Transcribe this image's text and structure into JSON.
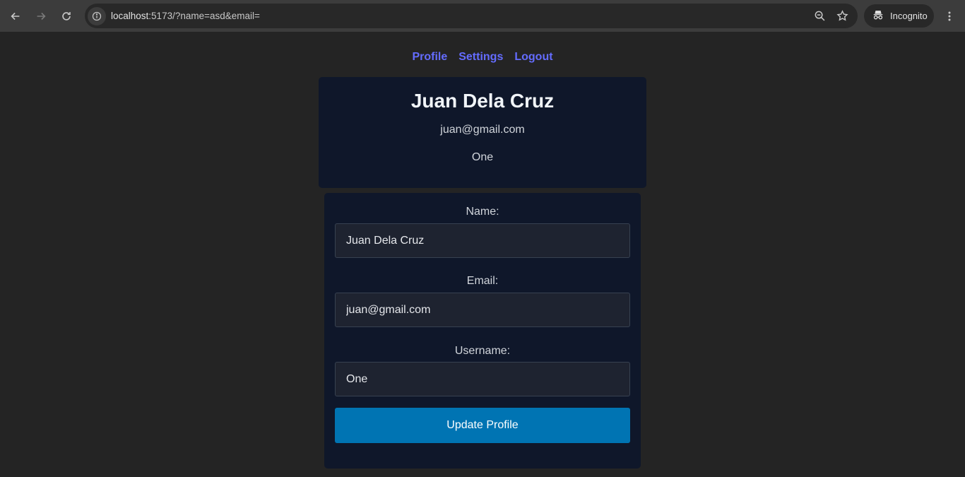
{
  "browser": {
    "url_host": "localhost",
    "url_rest": ":5173/?name=asd&email=",
    "incognito_label": "Incognito"
  },
  "nav": {
    "items": [
      "Profile",
      "Settings",
      "Logout"
    ]
  },
  "profile": {
    "name": "Juan Dela Cruz",
    "email": "juan@gmail.com",
    "username": "One"
  },
  "form": {
    "name_label": "Name:",
    "name_value": "Juan Dela Cruz",
    "email_label": "Email:",
    "email_value": "juan@gmail.com",
    "username_label": "Username:",
    "username_value": "One",
    "submit_label": "Update Profile"
  },
  "colors": {
    "background": "#242424",
    "card": "#0f172a",
    "link": "#646cff",
    "button": "#0074b3"
  }
}
